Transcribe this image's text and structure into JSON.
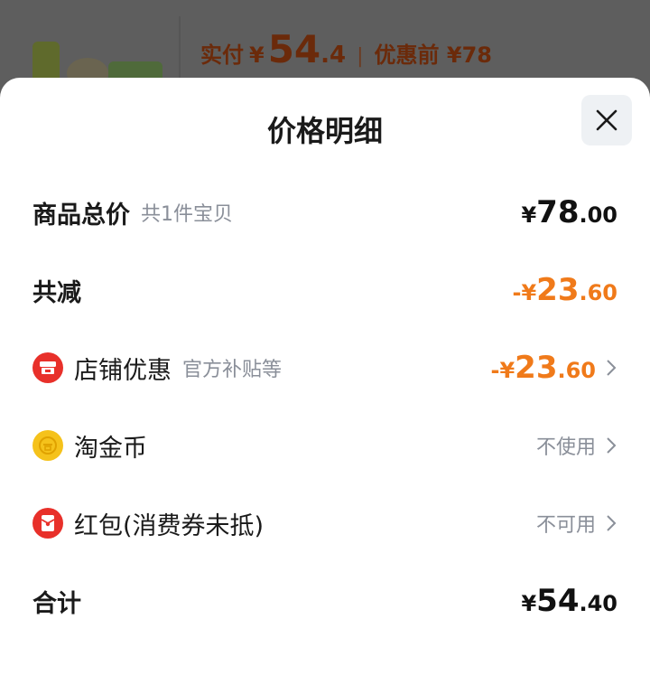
{
  "backdrop": {
    "paid_label": "实付",
    "currency": "¥",
    "paid_int": "54",
    "paid_dec": ".4",
    "separator": "|",
    "original_label": "优惠前 ¥78"
  },
  "sheet": {
    "title": "价格明细",
    "rows": {
      "total": {
        "label": "商品总价",
        "sub": "共1件宝贝",
        "sign": "¥",
        "int": "78",
        "dec": ".00"
      },
      "reduce": {
        "label": "共减",
        "sign": "-¥",
        "int": "23",
        "dec": ".60"
      },
      "shop": {
        "label": "店铺优惠",
        "sub": "官方补贴等",
        "sign": "-¥",
        "int": "23",
        "dec": ".60",
        "icon": "shop-icon"
      },
      "coin": {
        "label": "淘金币",
        "value": "不使用",
        "icon": "gold-coin-icon"
      },
      "redpacket": {
        "label": "红包(消费券未抵)",
        "value": "不可用",
        "icon": "red-packet-icon"
      },
      "sum": {
        "label": "合计",
        "sign": "¥",
        "int": "54",
        "dec": ".40"
      }
    }
  },
  "colors": {
    "accent_orange": "#f07a1a",
    "brand_red": "#e8302a",
    "coin_gold": "#f5c21b"
  }
}
